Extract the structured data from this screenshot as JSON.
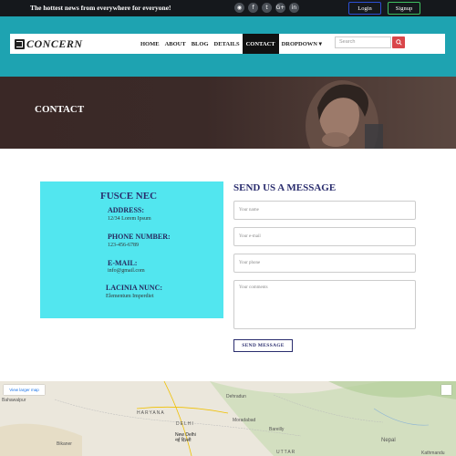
{
  "topbar": {
    "tagline": "The hottest news from everywhere for everyone!",
    "social": [
      "rss",
      "facebook",
      "twitter",
      "google-plus",
      "linkedin"
    ],
    "social_glyphs": [
      "◉",
      "f",
      "t",
      "G+",
      "in"
    ],
    "login_label": "Login",
    "signup_label": "Signup"
  },
  "header": {
    "logo": "CONCERN",
    "nav": [
      "HOME",
      "ABOUT",
      "BLOG",
      "DETAILS",
      "CONTACT",
      "DROPDOWN ▾"
    ],
    "active_nav": "CONTACT",
    "search_placeholder": "Search"
  },
  "hero": {
    "title": "CONTACT"
  },
  "info": {
    "title": "FUSCE NEC",
    "address_label": "ADDRESS:",
    "address_value": "12/34 Lorem Ipsum",
    "phone_label": "PHONE NUMBER:",
    "phone_value": "123-456-6789",
    "email_label": "E-MAIL:",
    "email_value": "info@gmail.com",
    "lacinia_label": "LACINIA NUNC:",
    "lacinia_value": "Elementum Imperdiet"
  },
  "form": {
    "title": "SEND US A MESSAGE",
    "name_placeholder": "Your name",
    "email_placeholder": "Your e-mail",
    "phone_placeholder": "Your phone",
    "comments_placeholder": "Your comments",
    "send_label": "SEND MESSAGE"
  },
  "map": {
    "view_larger": "View larger map",
    "labels": [
      "Bahawalpur",
      "HARYANA",
      "DELHI",
      "New Delhi",
      "नई दिल्ली",
      "Bareilly",
      "Nepal",
      "Kathmandu",
      "Bikaner",
      "UTTAR",
      "Moradabad",
      "Dehradun"
    ]
  },
  "colors": {
    "teal": "#1ea3b1",
    "info_bg": "#52e6ef",
    "navy": "#2a2d6e",
    "login_border": "#2c4fd4",
    "signup_border": "#3fbf5f",
    "search_btn": "#d9464a"
  }
}
